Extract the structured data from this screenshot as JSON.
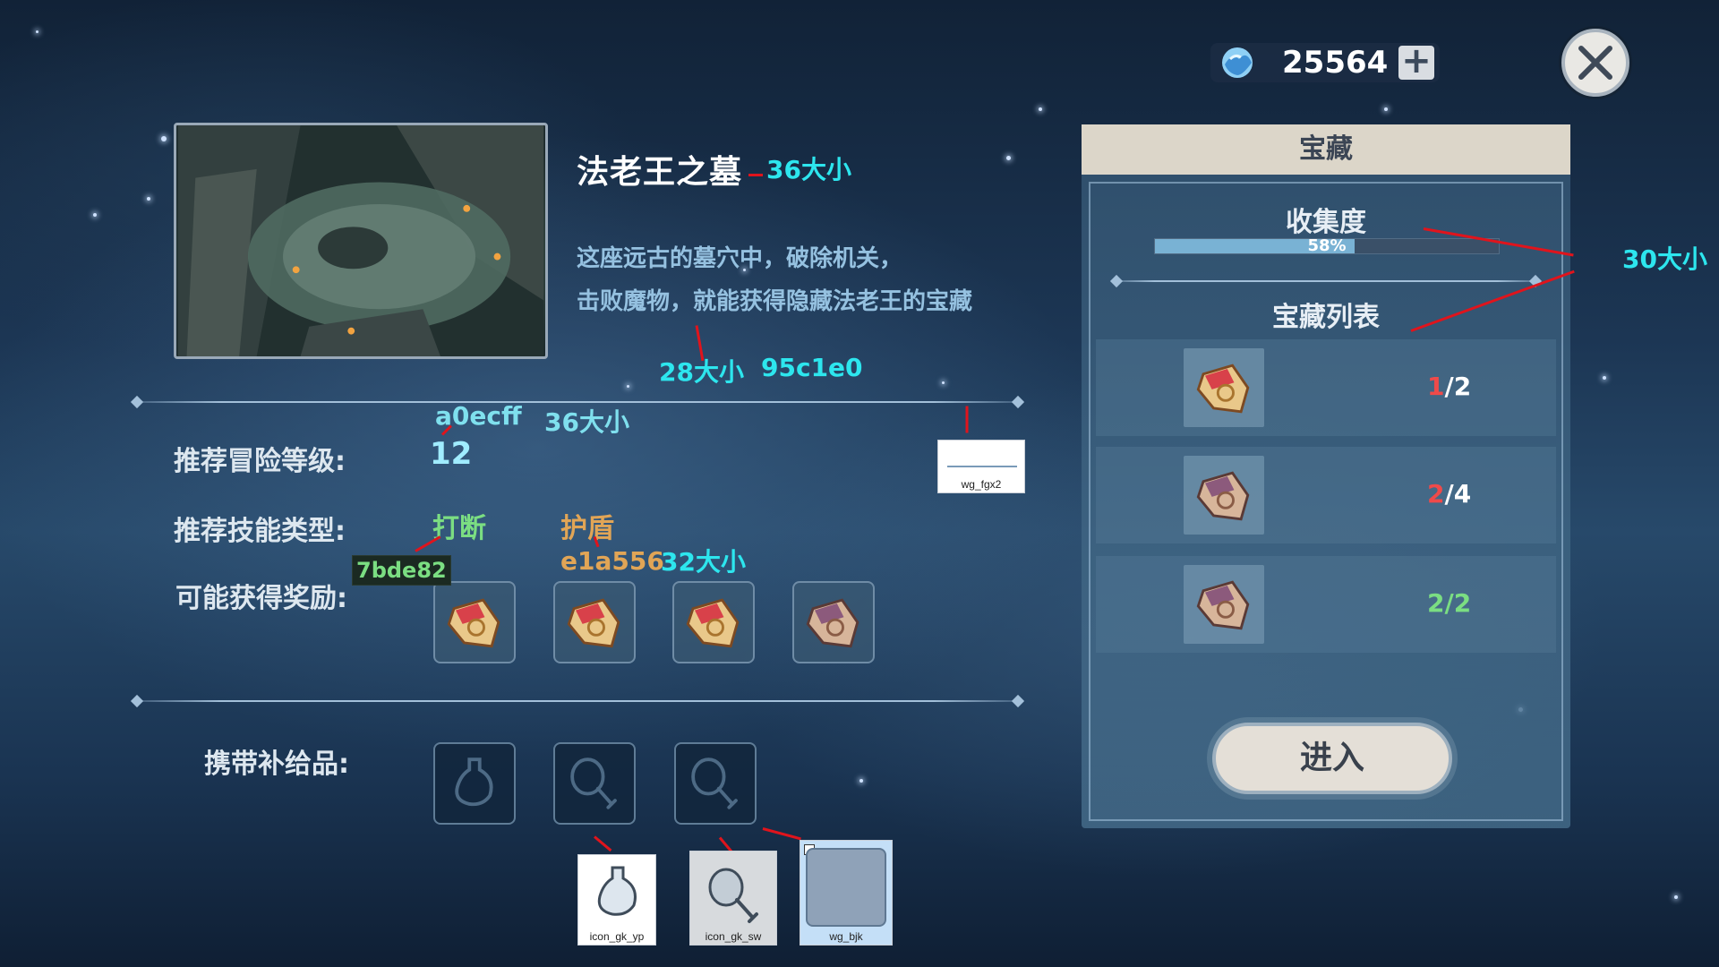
{
  "currency": {
    "icon": "crystal-gem-icon",
    "value": "25564",
    "plus_label": "+"
  },
  "close": {
    "icon": "close-x-icon"
  },
  "dungeon": {
    "title": "法老王之墓",
    "description_line1": "这座远古的墓穴中，破除机关，",
    "description_line2": "击败魔物，就能获得隐藏法老王的宝藏"
  },
  "info": {
    "level_label": "推荐冒险等级:",
    "level_value": "12",
    "skill_label": "推荐技能类型:",
    "skills": [
      "打断",
      "护盾"
    ],
    "reward_label": "可能获得奖励:",
    "supply_label": "携带补给品:"
  },
  "colors": {
    "level": "#a0ecff",
    "desc": "#95c1e0",
    "skill_green": "#7bde82",
    "skill_orange": "#e1a556"
  },
  "rewards": [
    {
      "icon": "treasure-map-gold-icon"
    },
    {
      "icon": "treasure-map-gold-icon"
    },
    {
      "icon": "treasure-map-gold-icon"
    },
    {
      "icon": "treasure-map-purple-icon"
    }
  ],
  "supplies": [
    {
      "icon": "potion-bottle-icon"
    },
    {
      "icon": "meat-drumstick-icon"
    },
    {
      "icon": "meat-drumstick-icon"
    }
  ],
  "panel": {
    "title": "宝藏",
    "collect_title": "收集度",
    "progress_percent": 58,
    "progress_text": "58%",
    "list_title": "宝藏列表",
    "items": [
      {
        "icon": "treasure-map-gold-icon",
        "have": "1",
        "total": "/2",
        "complete": false
      },
      {
        "icon": "treasure-map-purple-icon",
        "have": "2",
        "total": "/4",
        "complete": false
      },
      {
        "icon": "treasure-map-purple-icon",
        "have": "2/2",
        "total": "",
        "complete": true
      }
    ],
    "enter_label": "进入"
  },
  "annotations": {
    "title_size": "36大小",
    "desc_size": "28大小",
    "desc_color": "95c1e0",
    "level_color": "a0ecff",
    "level_size": "36大小",
    "skill_green_tag": "7bde82",
    "skill_orange_tag": "e1a556",
    "skill_size": "32大小",
    "panel_size": "30大小"
  },
  "assets": {
    "divider_asset": "wg_fgx2",
    "potion_asset": "icon_gk_yp",
    "meat_asset": "icon_gk_sw",
    "slot_asset": "wg_bjk"
  }
}
